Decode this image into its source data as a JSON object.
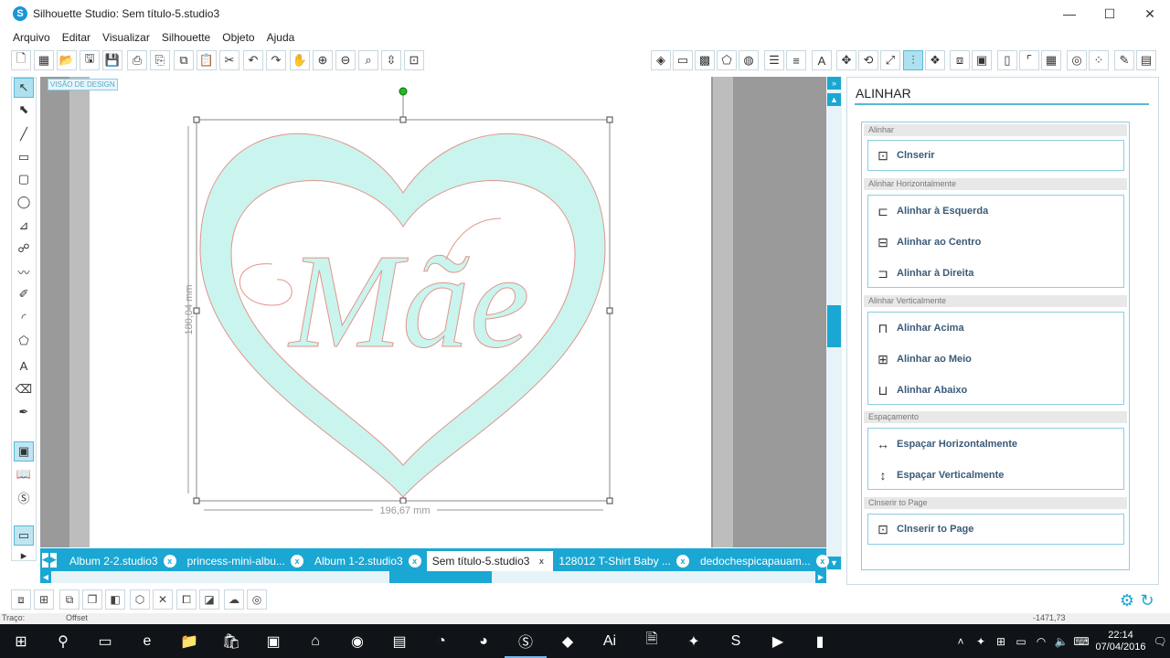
{
  "window": {
    "title": "Silhouette Studio: Sem título-5.studio3",
    "logo": "S",
    "minimize": "—",
    "maximize": "☐",
    "close": "✕"
  },
  "menu": [
    "Arquivo",
    "Editar",
    "Visualizar",
    "Silhouette",
    "Objeto",
    "Ajuda"
  ],
  "canvas": {
    "view_label": "VISÃO DE DESIGN",
    "text": "Mãe",
    "width_dim": "196,67 mm",
    "height_dim": "180,04 mm",
    "fill_color": "#c9f5ee",
    "stroke_color": "#e1948a"
  },
  "tabs": [
    {
      "label": "Album 2-2.studio3",
      "close": "x"
    },
    {
      "label": "princess-mini-albu...",
      "close": "x"
    },
    {
      "label": "Album 1-2.studio3",
      "close": "x"
    },
    {
      "label": "Sem título-5.studio3",
      "close": "x"
    },
    {
      "label": "128012 T-Shirt Baby ...",
      "close": "x"
    },
    {
      "label": "dedochespicapauam...",
      "close": "x"
    }
  ],
  "panel": {
    "title": "ALINHAR",
    "sections": [
      {
        "header": "Alinhar",
        "items": [
          {
            "label": "Clnserir",
            "icon": "center-icon"
          }
        ]
      },
      {
        "header": "Alinhar Horizontalmente",
        "items": [
          {
            "label": "Alinhar à Esquerda",
            "icon": "align-left-icon"
          },
          {
            "label": "Alinhar ao Centro",
            "icon": "align-center-icon"
          },
          {
            "label": "Alinhar à Direita",
            "icon": "align-right-icon"
          }
        ]
      },
      {
        "header": "Alinhar Verticalmente",
        "items": [
          {
            "label": "Alinhar Acima",
            "icon": "align-top-icon"
          },
          {
            "label": "Alinhar ao Meio",
            "icon": "align-middle-icon"
          },
          {
            "label": "Alinhar Abaixo",
            "icon": "align-bottom-icon"
          }
        ]
      },
      {
        "header": "Espaçamento",
        "items": [
          {
            "label": "Espaçar Horizontalmente",
            "icon": "space-horizontal-icon"
          },
          {
            "label": "Espaçar Verticalmente",
            "icon": "space-vertical-icon"
          }
        ]
      },
      {
        "header": "Clnserir to Page",
        "items": [
          {
            "label": "Clnserir to Page",
            "icon": "center-page-icon"
          }
        ]
      }
    ]
  },
  "status": {
    "traco": "Traço:",
    "offset": "Offset",
    "coords": "-1471,73"
  },
  "clock": {
    "time": "22:14",
    "date": "07/04/2016"
  },
  "colors": {
    "accent": "#1aa7d3"
  }
}
